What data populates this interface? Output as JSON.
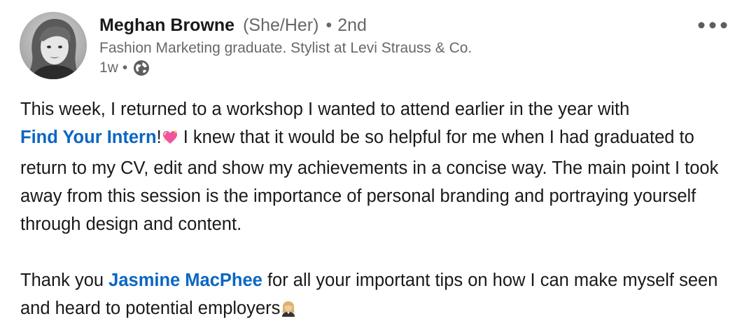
{
  "author": {
    "name": "Meghan Browne",
    "pronouns": "(She/Her)",
    "separator": "•",
    "degree": "2nd",
    "headline": "Fashion Marketing graduate. Stylist at Levi Strauss & Co.",
    "time": "1w",
    "visibility_icon": "globe-icon"
  },
  "menu_icon": "more-horizontal-icon",
  "post": {
    "p1_part1": "This week, I returned to a workshop I wanted to attend earlier in the year with",
    "mention1": "Find Your Intern",
    "p1_part2": "!",
    "emoji1": "sparkling-heart",
    "p1_part3": " I knew that it would be so helpful for me when I had graduated to return to my CV, edit and show my achievements in a concise way. The main point I took away from this session is the importance of personal branding and portraying yourself through design and content.",
    "p2_part1": "Thank you ",
    "mention2": "Jasmine MacPhee",
    "p2_part2": " for all your important tips on how I can make myself seen and heard to potential employers",
    "emoji2": "woman-office-worker"
  },
  "colors": {
    "link": "#0a66c2",
    "text": "#1f1f1f",
    "muted": "#666666"
  }
}
